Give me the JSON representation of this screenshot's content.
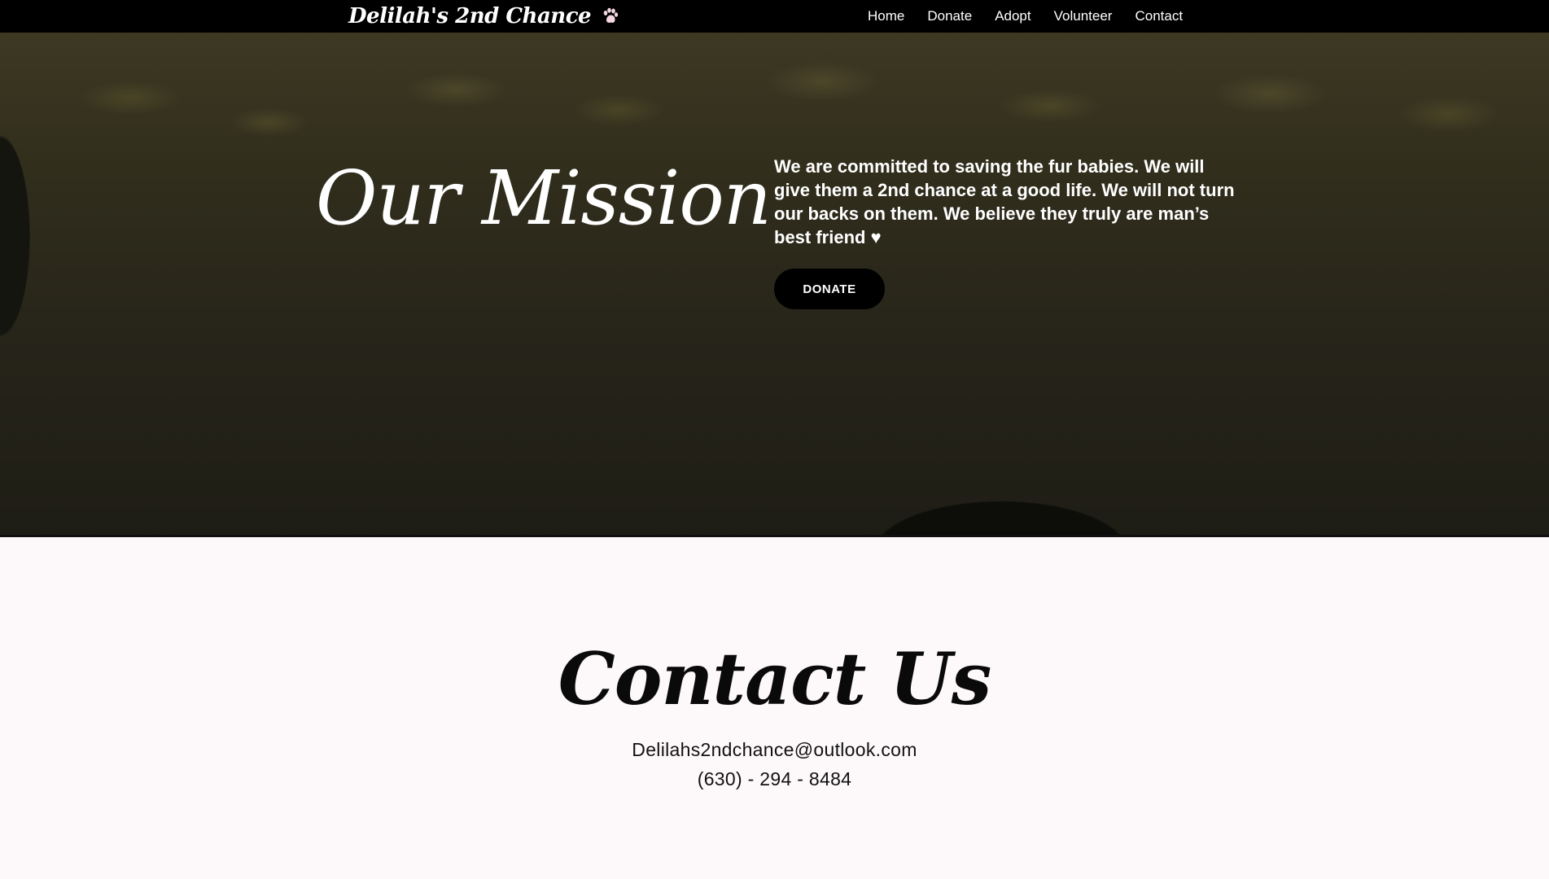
{
  "header": {
    "brand": "Delilah's 2nd Chance",
    "brand_icon": "paw-icon",
    "nav": [
      {
        "label": "Home"
      },
      {
        "label": "Donate"
      },
      {
        "label": "Adopt"
      },
      {
        "label": "Volunteer"
      },
      {
        "label": "Contact"
      }
    ]
  },
  "hero": {
    "title": "Our Mission",
    "text": "We are committed to saving the fur babies. We will give them a 2nd chance at a good life. We will not turn our backs on them. We believe they truly are man’s best friend ♥",
    "button_label": "DONATE"
  },
  "contact": {
    "title": "Contact Us",
    "email": "Delilahs2ndchance@outlook.com",
    "phone": "(630) - 294 - 8484"
  },
  "colors": {
    "navbar": "#000000",
    "contact_background": "#fdf8f9",
    "button": "#000000",
    "paw_icon": "#f6d6e2"
  }
}
